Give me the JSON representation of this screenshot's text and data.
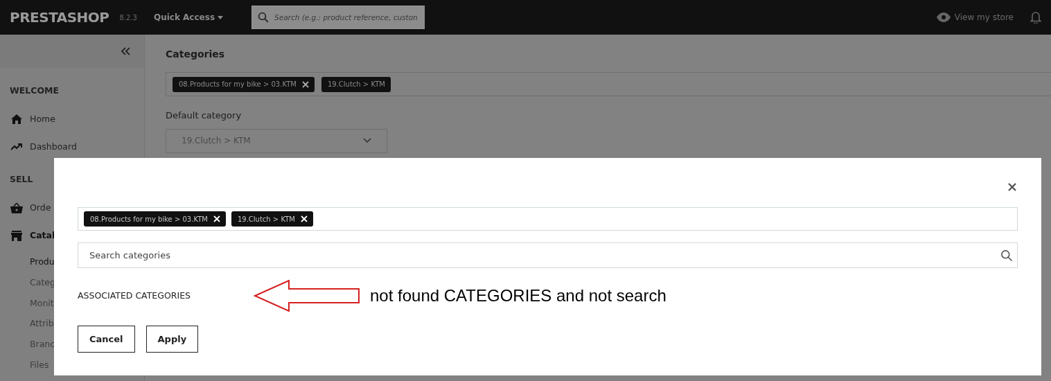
{
  "header": {
    "logo": "PRESTASHOP",
    "version": "8.2.3",
    "quick_access": "Quick Access",
    "search": {
      "placeholder": "Search (e.g.: product reference, custon"
    },
    "view_store": "View my store"
  },
  "sidebar": {
    "sections": [
      {
        "title": "WELCOME",
        "items": [
          {
            "label": "Home",
            "selected": false
          },
          {
            "label": "Dashboard",
            "selected": false
          }
        ]
      },
      {
        "title": "SELL",
        "items": [
          {
            "label": "Orde",
            "selected": false
          },
          {
            "label": "Catal",
            "selected": true,
            "children": [
              {
                "label": "Produ",
                "selected": true
              },
              {
                "label": "Categ",
                "selected": false
              },
              {
                "label": "Monit",
                "selected": false
              },
              {
                "label": "Attrib",
                "selected": false
              },
              {
                "label": "Branc",
                "selected": false
              },
              {
                "label": "Files",
                "selected": false
              }
            ]
          }
        ]
      }
    ]
  },
  "main": {
    "title": "Categories",
    "tags": [
      {
        "label": "08.Products for my bike > 03.KTM",
        "removable": true
      },
      {
        "label": "19.Clutch > KTM",
        "removable": false
      }
    ],
    "default_category_label": "Default category",
    "default_category_value": "19.Clutch > KTM"
  },
  "modal": {
    "tags": [
      {
        "label": "08.Products for my bike > 03.KTM",
        "removable": true
      },
      {
        "label": "19.Clutch > KTM",
        "removable": true
      }
    ],
    "search": {
      "placeholder": "Search categories"
    },
    "section_title": "ASSOCIATED CATEGORIES",
    "buttons": [
      "Cancel",
      "Apply"
    ]
  },
  "annotation": {
    "text": "not found CATEGORIES and not search"
  }
}
